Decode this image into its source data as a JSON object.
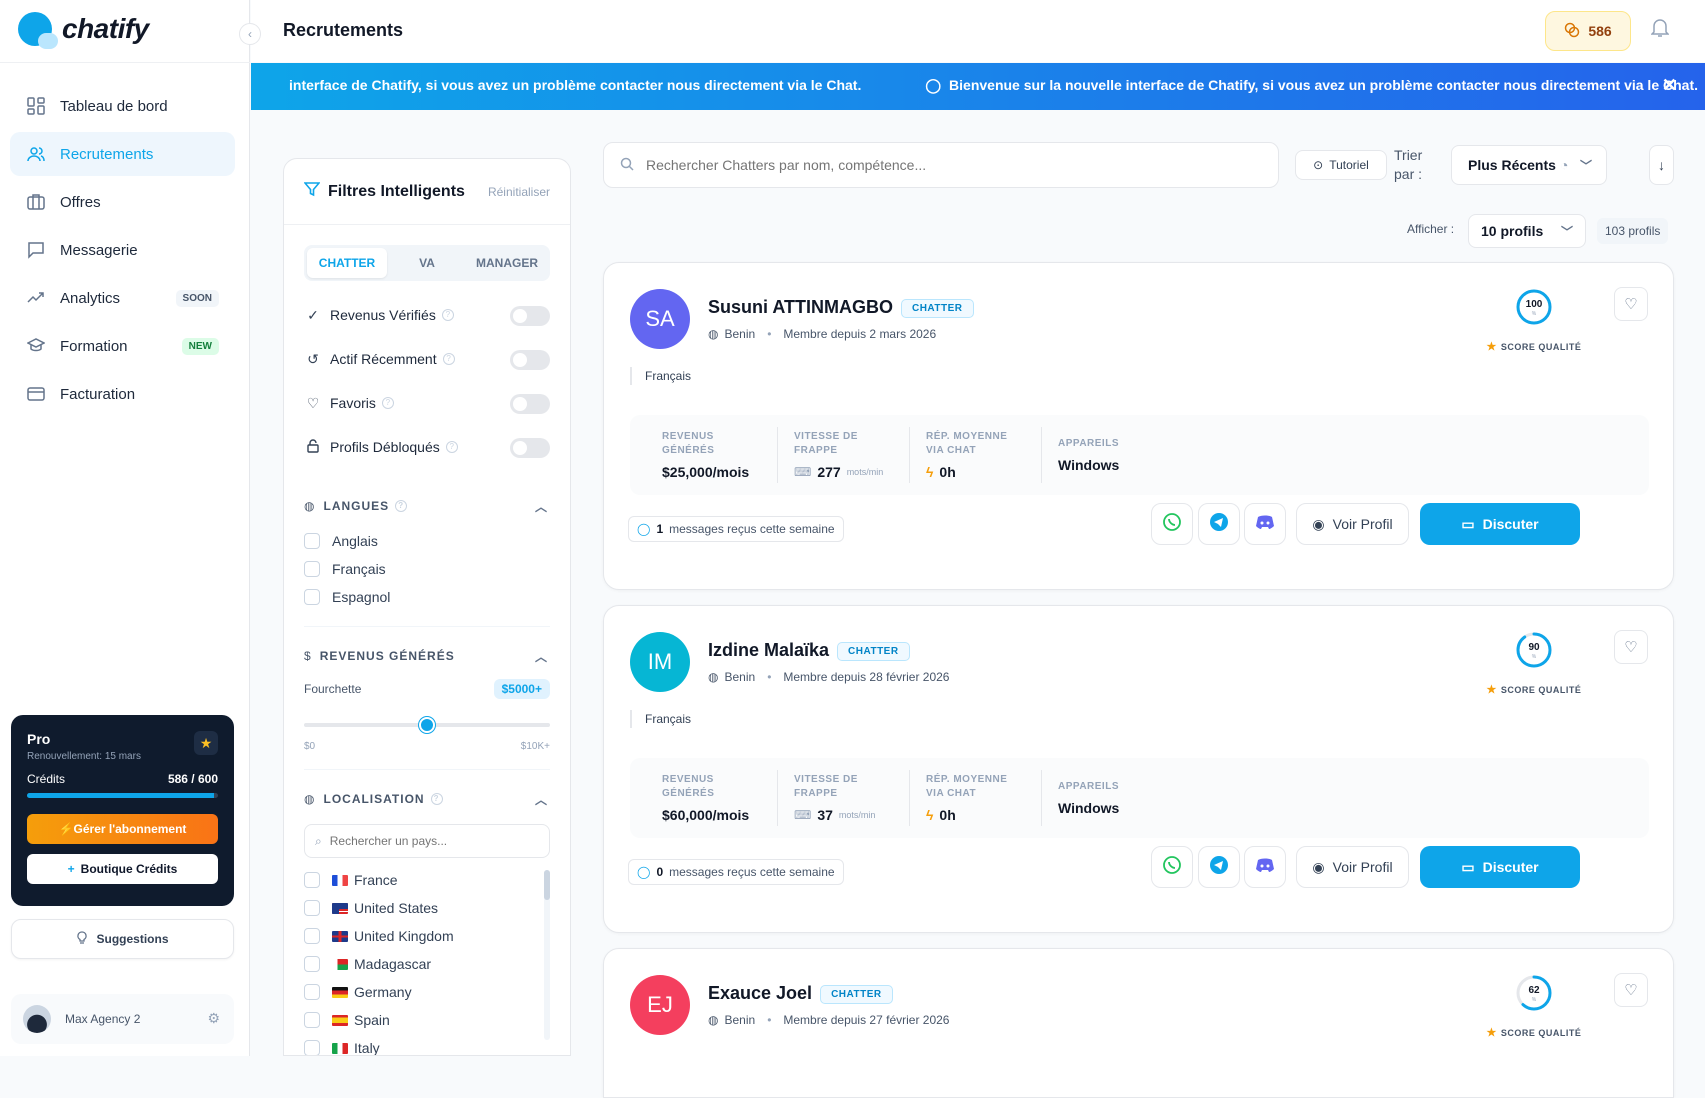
{
  "app": {
    "name": "chatify"
  },
  "sidebar": {
    "items": [
      {
        "label": "Tableau de bord"
      },
      {
        "label": "Recrutements"
      },
      {
        "label": "Offres"
      },
      {
        "label": "Messagerie"
      },
      {
        "label": "Analytics",
        "badge": "SOON"
      },
      {
        "label": "Formation",
        "badge": "NEW"
      },
      {
        "label": "Facturation"
      }
    ],
    "plan": {
      "name": "Pro",
      "renewal": "Renouvellement: 15 mars",
      "credits_label": "Crédits",
      "credits_value": "586 / 600",
      "credits_fraction": 0.977,
      "manage_label": "Gérer l'abonnement",
      "shop_label": "Boutique Crédits"
    },
    "suggestions_label": "Suggestions",
    "user": {
      "name": "Max Agency 2"
    }
  },
  "header": {
    "title": "Recrutements",
    "credits": "586"
  },
  "banner": {
    "text_partial": "interface de Chatify, si vous avez un problème contacter nous directement via le Chat.",
    "text": "Bienvenue sur la nouvelle interface de Chatify, si vous avez un problème contacter nous directement via le Chat."
  },
  "filters": {
    "title": "Filtres Intelligents",
    "reset": "Réinitialiser",
    "roles": [
      "CHATTER",
      "VA",
      "MANAGER"
    ],
    "toggles": [
      "Revenus Vérifiés",
      "Actif Récemment",
      "Favoris",
      "Profils Débloqués"
    ],
    "languages": {
      "title": "LANGUES",
      "options": [
        "Anglais",
        "Français",
        "Espagnol"
      ]
    },
    "revenue": {
      "title": "REVENUS GÉNÉRÉS",
      "range_label": "Fourchette",
      "value": "$5000+",
      "min": "$0",
      "max": "$10K+",
      "fraction": 0.5
    },
    "location": {
      "title": "LOCALISATION",
      "search_placeholder": "Rechercher un pays...",
      "countries": [
        "France",
        "United States",
        "United Kingdom",
        "Madagascar",
        "Germany",
        "Spain",
        "Italy"
      ]
    }
  },
  "search": {
    "placeholder": "Rechercher Chatters par nom, compétence..."
  },
  "toolbar": {
    "tutorial": "Tutoriel",
    "sort_label": "Trier par :",
    "sort_value": "Plus Récents",
    "show_label": "Afficher :",
    "show_value": "10 profils",
    "count": "103 profils"
  },
  "card_labels": {
    "score": "SCORE QUALITÉ",
    "revenue": "REVENUS GÉNÉRÉS",
    "typing": "VITESSE DE FRAPPE",
    "reply": "RÉP. MOYENNE VIA CHAT",
    "devices": "APPAREILS",
    "typing_unit": "mots/min",
    "messages_suffix": "messages reçus cette semaine",
    "view_profile": "Voir Profil",
    "chat": "Discuter"
  },
  "profiles": [
    {
      "initials": "SA",
      "name": "Susuni ATTINMAGBO",
      "role": "CHATTER",
      "country": "Benin",
      "since": "Membre depuis 2 mars 2026",
      "score": "100",
      "score_value": 100,
      "language": "Français",
      "revenue": "$25,000/mois",
      "typing": "277",
      "reply": "0h",
      "devices": "Windows",
      "messages": "1",
      "avatar_color": "#6366f1"
    },
    {
      "initials": "IM",
      "name": "Izdine Malaïka",
      "role": "CHATTER",
      "country": "Benin",
      "since": "Membre depuis 28 février 2026",
      "score": "90",
      "score_value": 90,
      "language": "Français",
      "revenue": "$60,000/mois",
      "typing": "37",
      "reply": "0h",
      "devices": "Windows",
      "messages": "0",
      "avatar_color": "#06b6d4"
    },
    {
      "initials": "EJ",
      "name": "Exauce Joel",
      "role": "CHATTER",
      "country": "Benin",
      "since": "Membre depuis 27 février 2026",
      "score": "62",
      "score_value": 62,
      "avatar_color": "#f43f5e"
    }
  ],
  "colors": {
    "accent": "#0ea5e9",
    "dark": "#0f1b2d"
  }
}
